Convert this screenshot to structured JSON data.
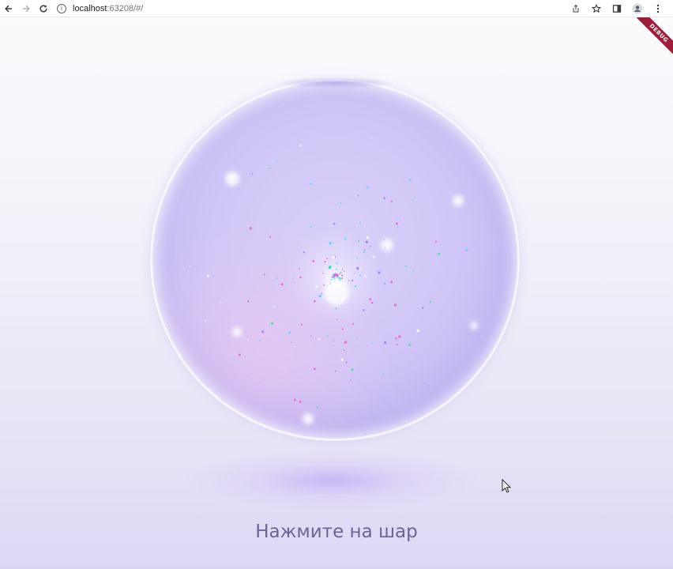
{
  "browser": {
    "url_host": "localhost",
    "url_rest": ":63208/#/",
    "icons": {
      "back": "arrow-left-icon",
      "forward": "arrow-right-icon",
      "reload": "reload-icon",
      "site_info": "info-icon",
      "share": "share-icon",
      "bookmark": "star-icon",
      "side_panel": "side-panel-icon",
      "profile": "profile-icon",
      "menu": "kebab-menu-icon"
    }
  },
  "app": {
    "debug_banner": "DEBUG",
    "prompt": "Нажмите на шар",
    "colors": {
      "prompt": "#6b6592",
      "orb": "#cfc6f6",
      "banner": "#a01d3a"
    }
  }
}
